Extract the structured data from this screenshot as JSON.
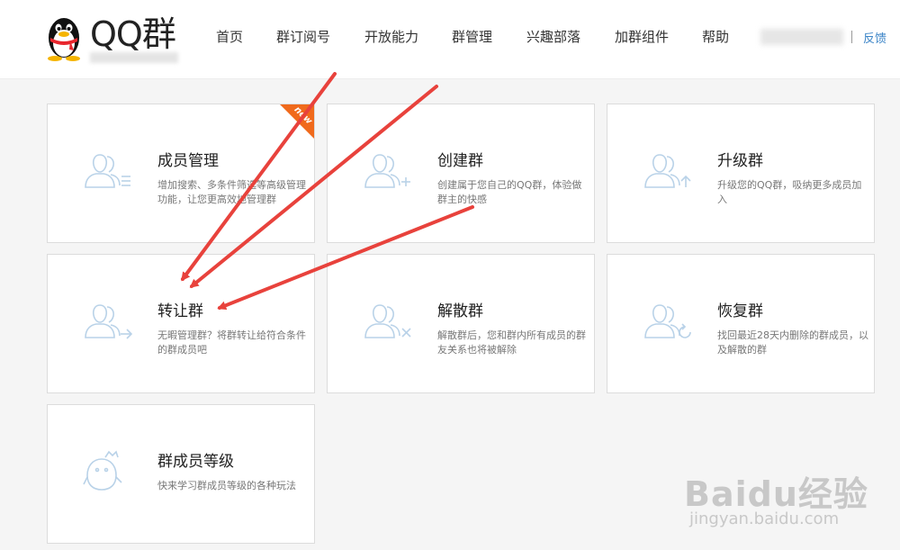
{
  "header": {
    "logo_text": "QQ群",
    "nav": [
      {
        "label": "首页"
      },
      {
        "label": "群订阅号"
      },
      {
        "label": "开放能力"
      },
      {
        "label": "群管理"
      },
      {
        "label": "兴趣部落"
      },
      {
        "label": "加群组件"
      },
      {
        "label": "帮助"
      }
    ],
    "feedback": "反馈"
  },
  "cards": [
    {
      "title": "成员管理",
      "desc": "增加搜索、多条件筛选等高级管理功能，让您更高效地管理群",
      "badge": "new",
      "icon": "members-list-icon"
    },
    {
      "title": "创建群",
      "desc": "创建属于您自己的QQ群，体验做群主的快感",
      "icon": "add-user-icon"
    },
    {
      "title": "升级群",
      "desc": "升级您的QQ群，吸纳更多成员加入",
      "icon": "upgrade-group-icon"
    },
    {
      "title": "转让群",
      "desc": "无暇管理群？将群转让给符合条件的群成员吧",
      "icon": "transfer-group-icon"
    },
    {
      "title": "解散群",
      "desc": "解散群后，您和群内所有成员的群友关系也将被解除",
      "icon": "dissolve-group-icon"
    },
    {
      "title": "恢复群",
      "desc": "找回最近28天内删除的群成员，以及解散的群",
      "icon": "restore-group-icon"
    },
    {
      "title": "群成员等级",
      "desc": "快来学习群成员等级的各种玩法",
      "icon": "penguin-level-icon"
    }
  ],
  "watermark": {
    "main": "Baidu经验",
    "sub": "jingyan.baidu.com"
  },
  "colors": {
    "accent": "#3b84c7",
    "badge": "#f06a1c",
    "arrow": "#e8423c",
    "icon": "#b9d2e8"
  }
}
